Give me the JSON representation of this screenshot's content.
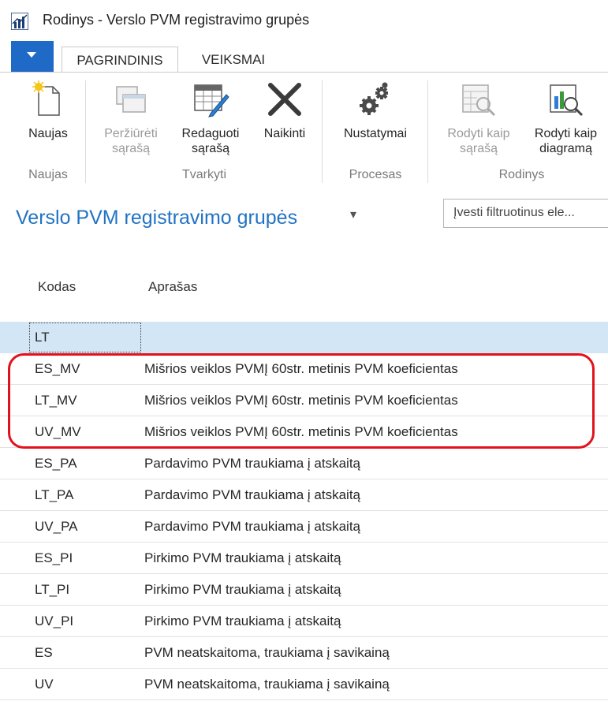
{
  "window": {
    "title": "Rodinys - Verslo PVM registravimo grupės"
  },
  "tabs": [
    {
      "label": "PAGRINDINIS",
      "active": true
    },
    {
      "label": "VEIKSMAI",
      "active": false
    }
  ],
  "ribbon": {
    "buttons": {
      "new": {
        "label": "Naujas",
        "icon": "new-document-icon"
      },
      "view_list": {
        "label": "Peržiūrėti\nsąrašą",
        "icon": "view-list-icon",
        "enabled": false
      },
      "edit_list": {
        "label": "Redaguoti\nsąrašą",
        "icon": "edit-list-icon"
      },
      "delete": {
        "label": "Naikinti",
        "icon": "delete-x-icon"
      },
      "settings": {
        "label": "Nustatymai",
        "icon": "gears-icon"
      },
      "show_list": {
        "label": "Rodyti kaip\nsąrašą",
        "icon": "show-as-list-icon",
        "enabled": false
      },
      "show_chart": {
        "label": "Rodyti kaip\ndiagramą",
        "icon": "show-as-chart-icon"
      }
    },
    "groups": {
      "new": "Naujas",
      "manage": "Tvarkyti",
      "process": "Procesas",
      "view": "Rodinys"
    }
  },
  "page": {
    "title": "Verslo PVM registravimo grupės",
    "filter_placeholder": "Įvesti filtruotinus ele..."
  },
  "table": {
    "headers": {
      "code": "Kodas",
      "description": "Aprašas"
    },
    "rows": [
      {
        "code": "LT",
        "description": "",
        "selected": true
      },
      {
        "code": "ES_MV",
        "description": "Mišrios veiklos PVMĮ 60str. metinis PVM koeficientas"
      },
      {
        "code": "LT_MV",
        "description": "Mišrios veiklos PVMĮ 60str. metinis PVM koeficientas"
      },
      {
        "code": "UV_MV",
        "description": "Mišrios veiklos PVMĮ 60str. metinis PVM koeficientas"
      },
      {
        "code": "ES_PA",
        "description": "Pardavimo PVM traukiama į atskaitą"
      },
      {
        "code": "LT_PA",
        "description": "Pardavimo PVM traukiama į atskaitą"
      },
      {
        "code": "UV_PA",
        "description": "Pardavimo PVM traukiama į atskaitą"
      },
      {
        "code": "ES_PI",
        "description": "Pirkimo PVM traukiama į atskaitą"
      },
      {
        "code": "LT_PI",
        "description": "Pirkimo PVM traukiama į atskaitą"
      },
      {
        "code": "UV_PI",
        "description": "Pirkimo PVM traukiama į atskaitą"
      },
      {
        "code": "ES",
        "description": "PVM neatskaitoma, traukiama į savikainą"
      },
      {
        "code": "UV",
        "description": "PVM neatskaitoma, traukiama į savikainą"
      }
    ]
  },
  "colors": {
    "accent": "#2273c3",
    "file_button": "#1f6ac7",
    "selection": "#d3e6f6",
    "annotation": "#e3111c"
  }
}
